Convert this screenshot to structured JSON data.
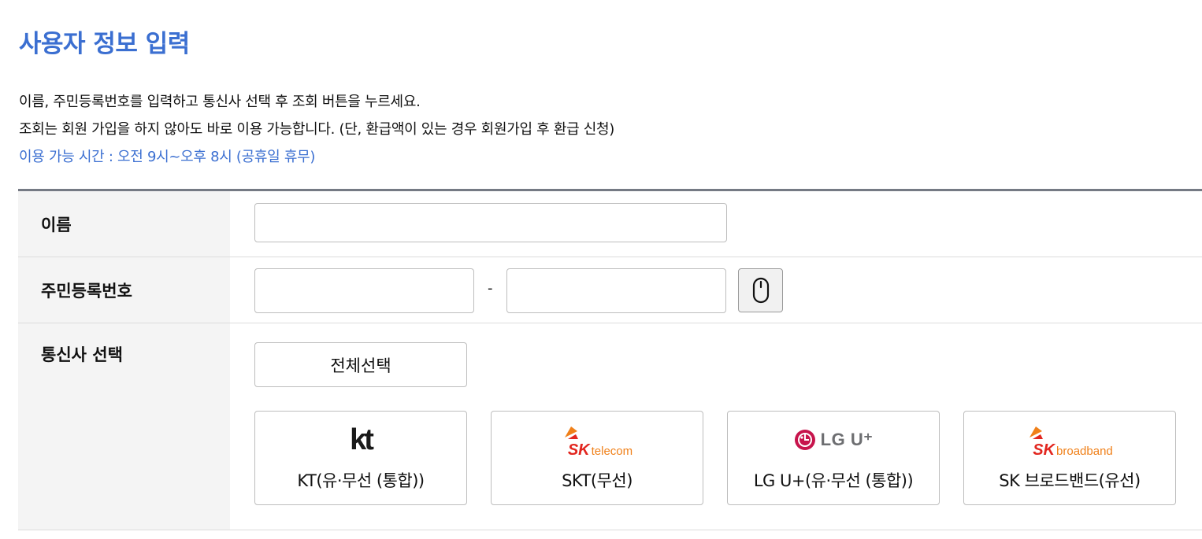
{
  "title": "사용자 정보 입력",
  "description": {
    "line1": "이름, 주민등록번호를 입력하고 통신사 선택 후 조회 버튼을 누르세요.",
    "line2": "조회는 회원 가입을 하지 않아도 바로 이용 가능합니다. (단, 환급액이 있는 경우 회원가입 후 환급 신청)",
    "hours": "이용 가능 시간 : 오전 9시~오후 8시 (공휴일 휴무)"
  },
  "form": {
    "name_label": "이름",
    "name_value": "",
    "rrn_label": "주민등록번호",
    "rrn_front_value": "",
    "rrn_separator": "-",
    "rrn_back_value": "",
    "keypad_icon": "mouse-icon",
    "carrier_label": "통신사 선택",
    "select_all": "전체선택",
    "carriers": [
      {
        "label": "KT(유·무선 (통합))",
        "logo_text": "kt",
        "icon": "kt-logo-icon"
      },
      {
        "label": "SKT(무선)",
        "logo_mark": "SK",
        "logo_sub": "telecom",
        "icon": "sk-telecom-logo-icon"
      },
      {
        "label": "LG U+(유·무선 (통합))",
        "logo_text": "LG U⁺",
        "icon": "lg-uplus-logo-icon"
      },
      {
        "label": "SK 브로드밴드(유선)",
        "logo_mark": "SK",
        "logo_sub": "broadband",
        "icon": "sk-broadband-logo-icon"
      }
    ]
  },
  "colors": {
    "accent": "#3b6fd1",
    "label_bg": "#f4f4f4",
    "border": "#bdbdbd",
    "sk_red": "#e2261f",
    "sk_orange": "#f08019",
    "lg_magenta": "#c7144c",
    "lg_gray": "#6d6e71"
  }
}
